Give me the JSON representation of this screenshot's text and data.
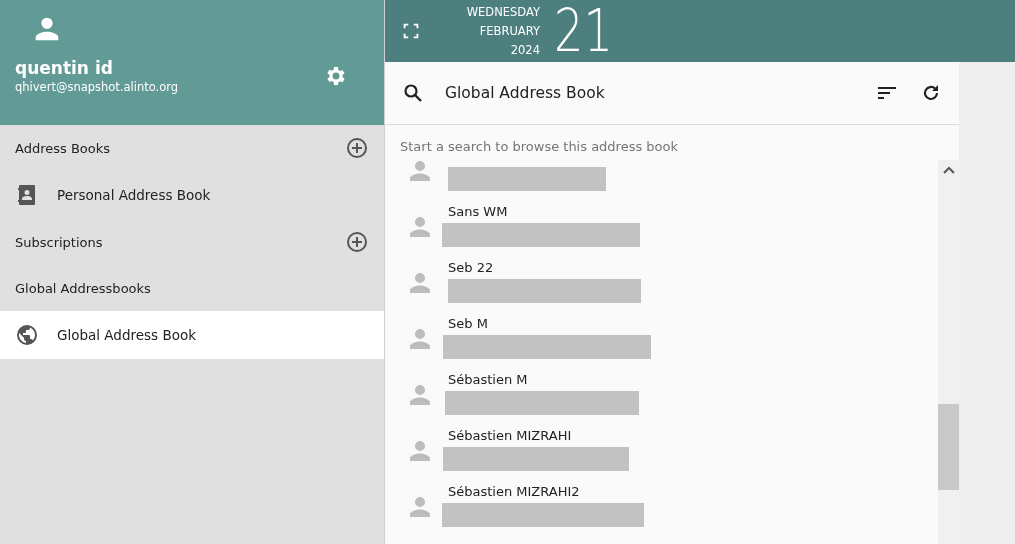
{
  "account": {
    "name": "quentin id",
    "email": "qhivert@snapshot.alinto.org"
  },
  "sidebar": {
    "sections": [
      {
        "title": "Address Books",
        "addable": true,
        "items": [
          {
            "label": "Personal Address Book",
            "kind": "personal",
            "selected": false
          }
        ]
      },
      {
        "title": "Subscriptions",
        "addable": true
      },
      {
        "title": "Global Addressbooks",
        "addable": false,
        "items": [
          {
            "label": "Global Address Book",
            "kind": "global",
            "selected": true
          }
        ]
      }
    ]
  },
  "date": {
    "weekday": "WEDNESDAY",
    "month": "FEBRUARY",
    "year": "2024",
    "day": "21"
  },
  "toolbar": {
    "title": "Global Address Book"
  },
  "hint": "Start a search to browse this address book",
  "contacts": [
    {
      "redacted": true
    },
    {
      "name": "Sans WM",
      "redacted": true
    },
    {
      "name": "Seb 22",
      "redacted": true
    },
    {
      "name": "Seb M",
      "redacted": true
    },
    {
      "name": "Sébastien M",
      "redacted": true
    },
    {
      "name": "Sébastien MIZRAHI",
      "redacted": true
    },
    {
      "name": "Sébastien MIZRAHI2",
      "redacted": true
    }
  ]
}
